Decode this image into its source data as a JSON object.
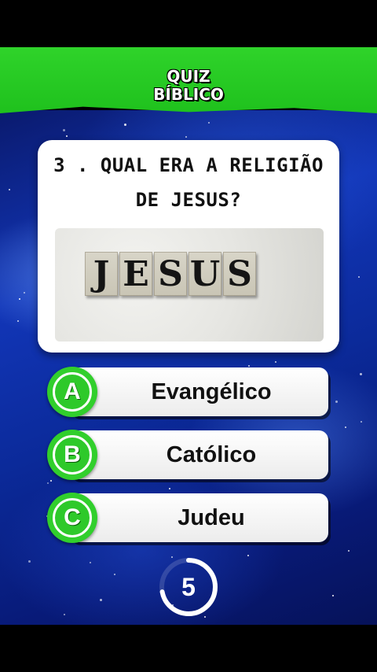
{
  "header": {
    "title_line1": "QUIZ",
    "title_line2": "BÍBLICO"
  },
  "question": {
    "number_text": "3 . QUAL ERA A RELIGIÃO",
    "text_line2": "DE JESUS?",
    "image_letters": [
      "J",
      "E",
      "S",
      "U",
      "S"
    ]
  },
  "options": [
    {
      "letter": "A",
      "text": "Evangélico"
    },
    {
      "letter": "B",
      "text": "Católico"
    },
    {
      "letter": "C",
      "text": "Judeu"
    }
  ],
  "timer": {
    "seconds_left": "5",
    "progress": 0.72
  },
  "colors": {
    "accent_green": "#2ec92a",
    "background_blue": "#1236b8",
    "card": "#ffffff"
  }
}
